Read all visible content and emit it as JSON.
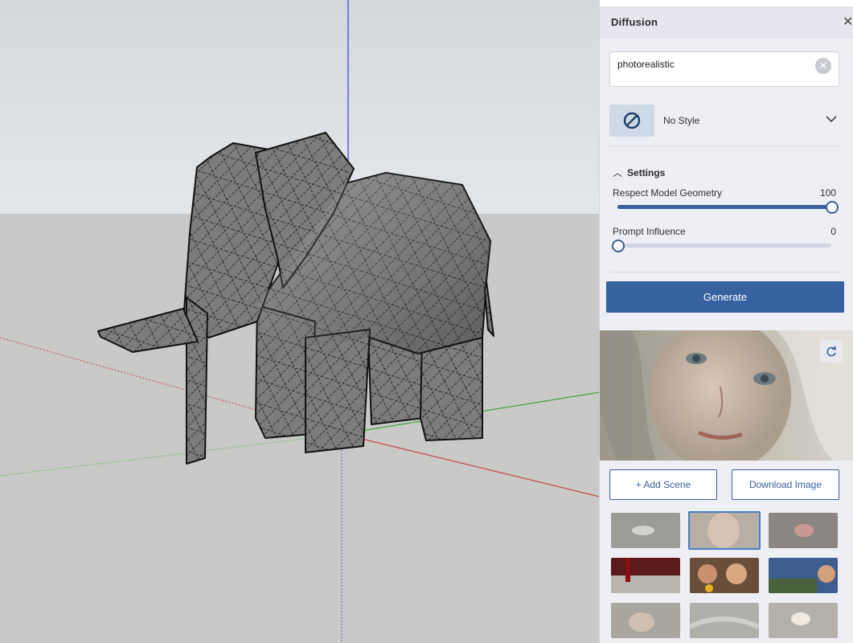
{
  "panel": {
    "title": "Diffusion",
    "close_icon": "close-icon"
  },
  "prompt": {
    "value": "photorealistic",
    "clear_icon": "clear-icon"
  },
  "style": {
    "icon": "no-style-icon",
    "label": "No Style",
    "dropdown_icon": "chevron-down-icon"
  },
  "settings": {
    "label": "Settings",
    "sliders": [
      {
        "label": "Respect Model Geometry",
        "value": "100",
        "fraction": 1.0
      },
      {
        "label": "Prompt Influence",
        "value": "0",
        "fraction": 0.0
      }
    ]
  },
  "actions": {
    "generate": "Generate",
    "add_scene": "+ Add Scene",
    "download": "Download Image",
    "refresh_icon": "refresh-icon"
  },
  "colors": {
    "accent": "#3861a0",
    "panel_bg": "#eeeff5",
    "axis_red": "#c44a4a",
    "axis_green": "#3fa33f",
    "axis_blue": "#3a3ad0"
  },
  "gallery": {
    "selected_index": 1,
    "thumbnails": [
      "sketch-hand",
      "portrait-girl",
      "pink-nose",
      "red-curtain",
      "cartoon-woman",
      "sky-woman",
      "sleeping-face",
      "gray-fabric",
      "white-shell"
    ]
  }
}
